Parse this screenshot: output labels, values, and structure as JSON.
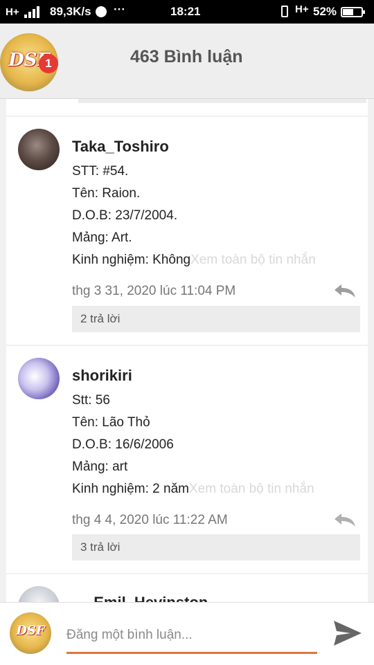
{
  "status_bar": {
    "network_left": "H+",
    "speed": "89,3K/s",
    "more": "···",
    "time": "18:21",
    "network_right": "H+",
    "battery": "52%"
  },
  "header": {
    "title": "463 Bình luận",
    "logo_text": "DSF",
    "badge": "1"
  },
  "comments": [
    {
      "username": "Taka_Toshiro",
      "lines": [
        "STT: #54.",
        "Tên: Raion.",
        "D.O.B: 23/7/2004.",
        "Mảng: Art.",
        "Kinh nghiệm: Không"
      ],
      "see_all": "Xem toàn bộ tin nhắn",
      "time": "thg 3 31, 2020 lúc 11:04 PM",
      "replies": "2 trả lời"
    },
    {
      "username": "shorikiri",
      "lines": [
        "Stt: 56",
        "Tên: Lão Thỏ",
        "D.O.B: 16/6/2006",
        "Mảng: art",
        "Kinh nghiệm: 2 năm"
      ],
      "see_all": "Xem toàn bộ tin nhắn",
      "time": "thg 4 4, 2020 lúc 11:22 AM",
      "replies": "3 trả lời"
    },
    {
      "username": "_Emil_Hevinston"
    }
  ],
  "composer": {
    "placeholder": "Đăng một bình luận...",
    "avatar_text": "DSF"
  },
  "colors": {
    "accent": "#e0743a",
    "badge": "#e53935",
    "header_bg": "#eeeeee"
  }
}
